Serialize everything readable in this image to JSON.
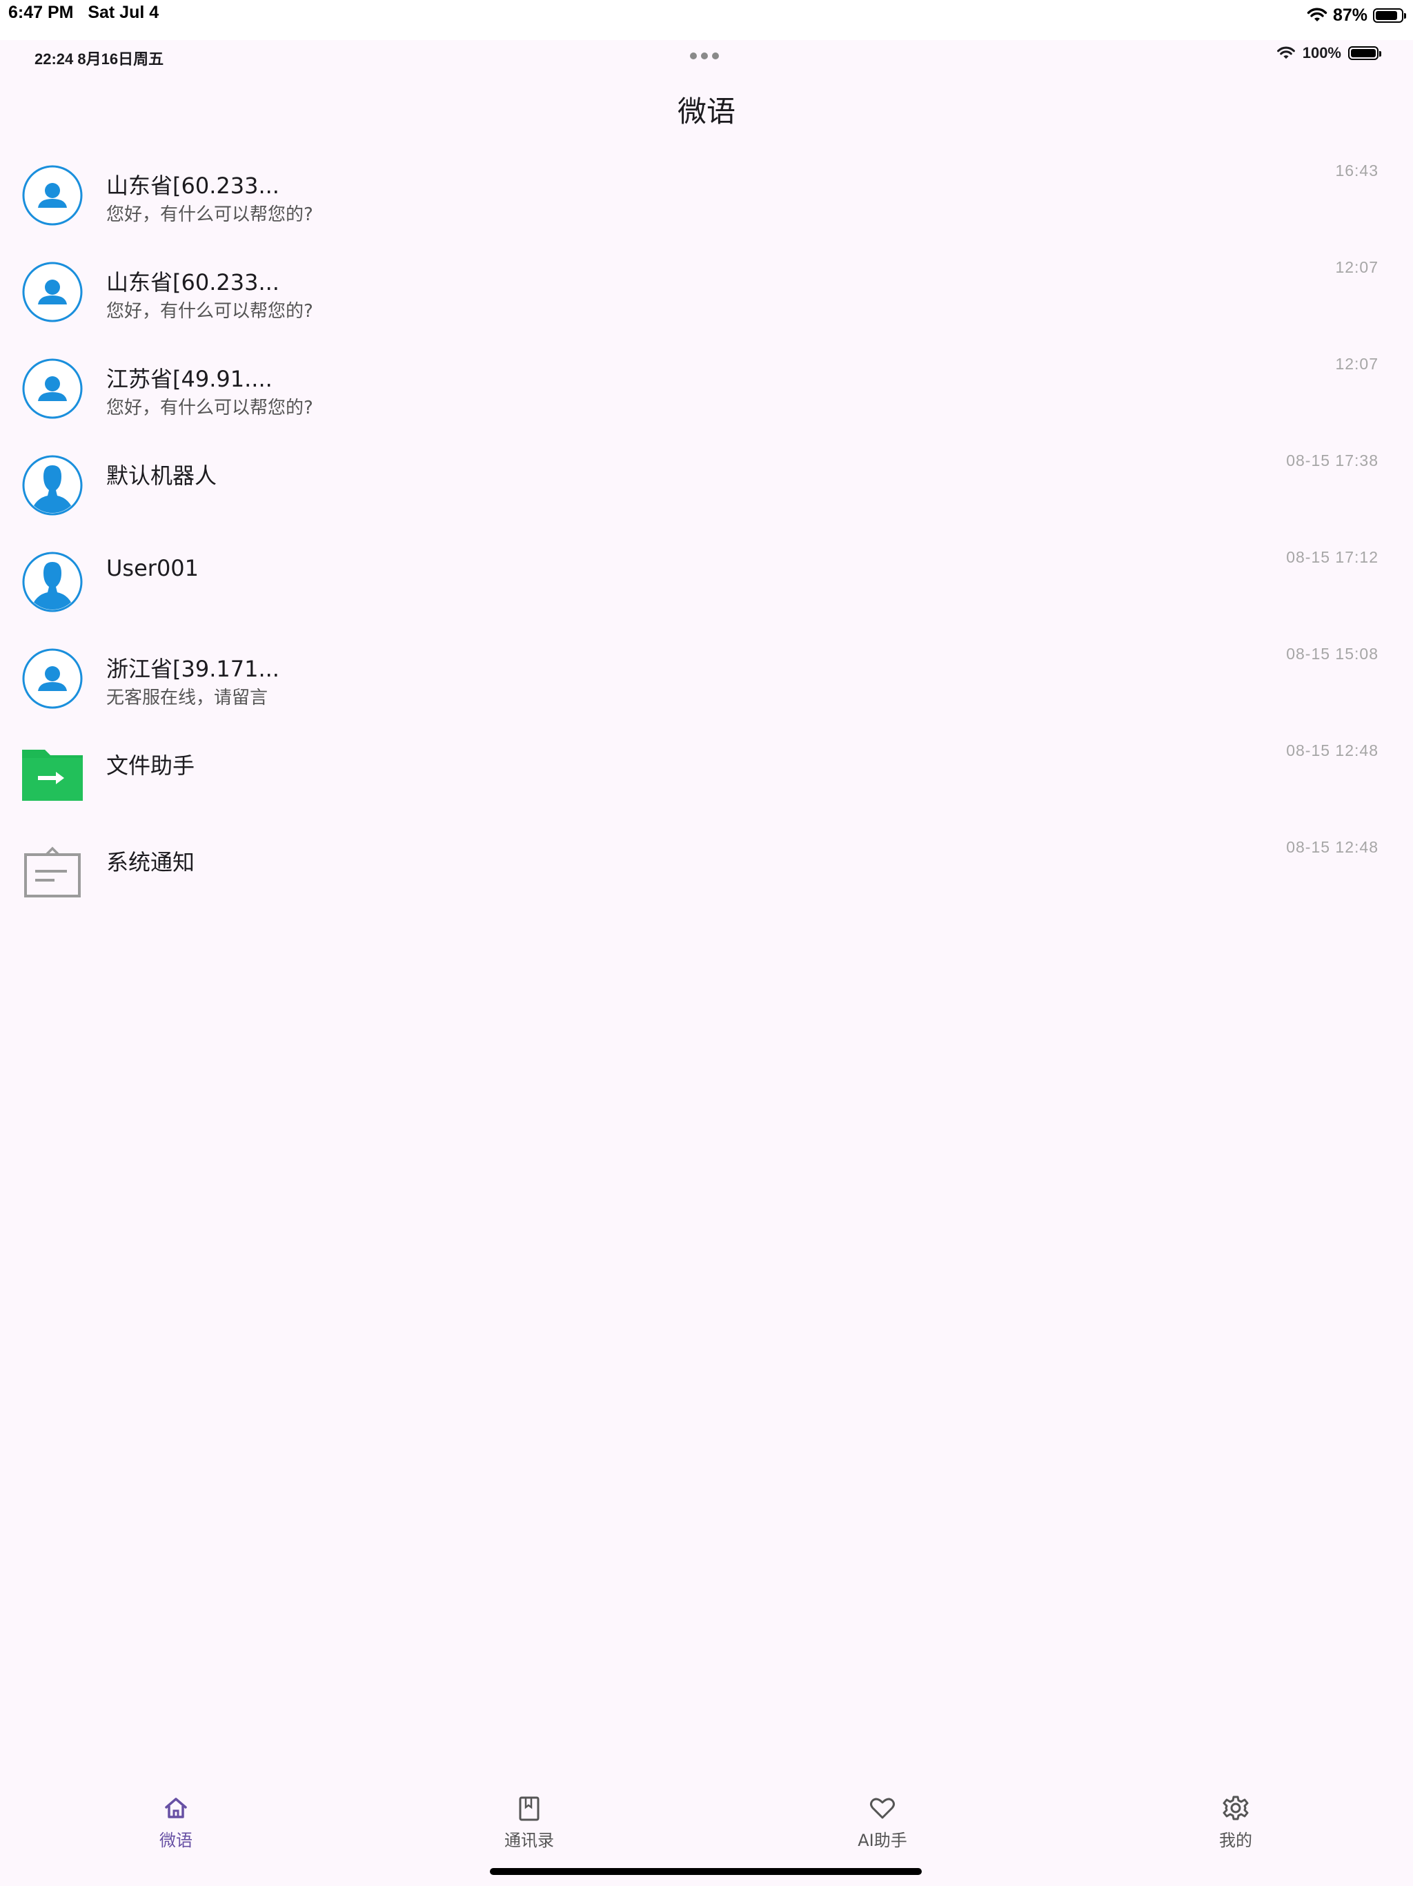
{
  "device_status": {
    "time": "6:47 PM",
    "date": "Sat Jul 4",
    "battery": "87%",
    "battery_level": 0.87
  },
  "app_status": {
    "time_date": "22:24   8月16日周五",
    "battery": "100%",
    "battery_level": 1.0
  },
  "header": {
    "title": "微语"
  },
  "conversations": [
    {
      "name": "山东省[60.233...",
      "preview": "您好，有什么可以帮您的?",
      "time": "16:43",
      "avatar": "person-icon"
    },
    {
      "name": "山东省[60.233...",
      "preview": "您好，有什么可以帮您的?",
      "time": "12:07",
      "avatar": "person-icon"
    },
    {
      "name": "江苏省[49.91....",
      "preview": "您好，有什么可以帮您的?",
      "time": "12:07",
      "avatar": "person-icon"
    },
    {
      "name": "默认机器人",
      "preview": "",
      "time": "08-15 17:38",
      "avatar": "profile-silhouette-icon"
    },
    {
      "name": "User001",
      "preview": "",
      "time": "08-15 17:12",
      "avatar": "profile-silhouette-icon"
    },
    {
      "name": "浙江省[39.171...",
      "preview": "无客服在线，请留言",
      "time": "08-15 15:08",
      "avatar": "person-icon"
    },
    {
      "name": "文件助手",
      "preview": "",
      "time": "08-15 12:48",
      "avatar": "folder-arrow-icon"
    },
    {
      "name": "系统通知",
      "preview": "",
      "time": "08-15 12:48",
      "avatar": "notification-board-icon"
    }
  ],
  "tabs": [
    {
      "label": "微语",
      "icon": "home-icon",
      "active": true
    },
    {
      "label": "通讯录",
      "icon": "contacts-book-icon",
      "active": false
    },
    {
      "label": "AI助手",
      "icon": "heart-icon",
      "active": false
    },
    {
      "label": "我的",
      "icon": "settings-gear-icon",
      "active": false
    }
  ],
  "colors": {
    "background": "#fdf7fd",
    "accent": "#6750a4",
    "avatar_blue": "#1a8fdc",
    "folder_green": "#1db954",
    "time_gray": "#a6a6a6"
  }
}
